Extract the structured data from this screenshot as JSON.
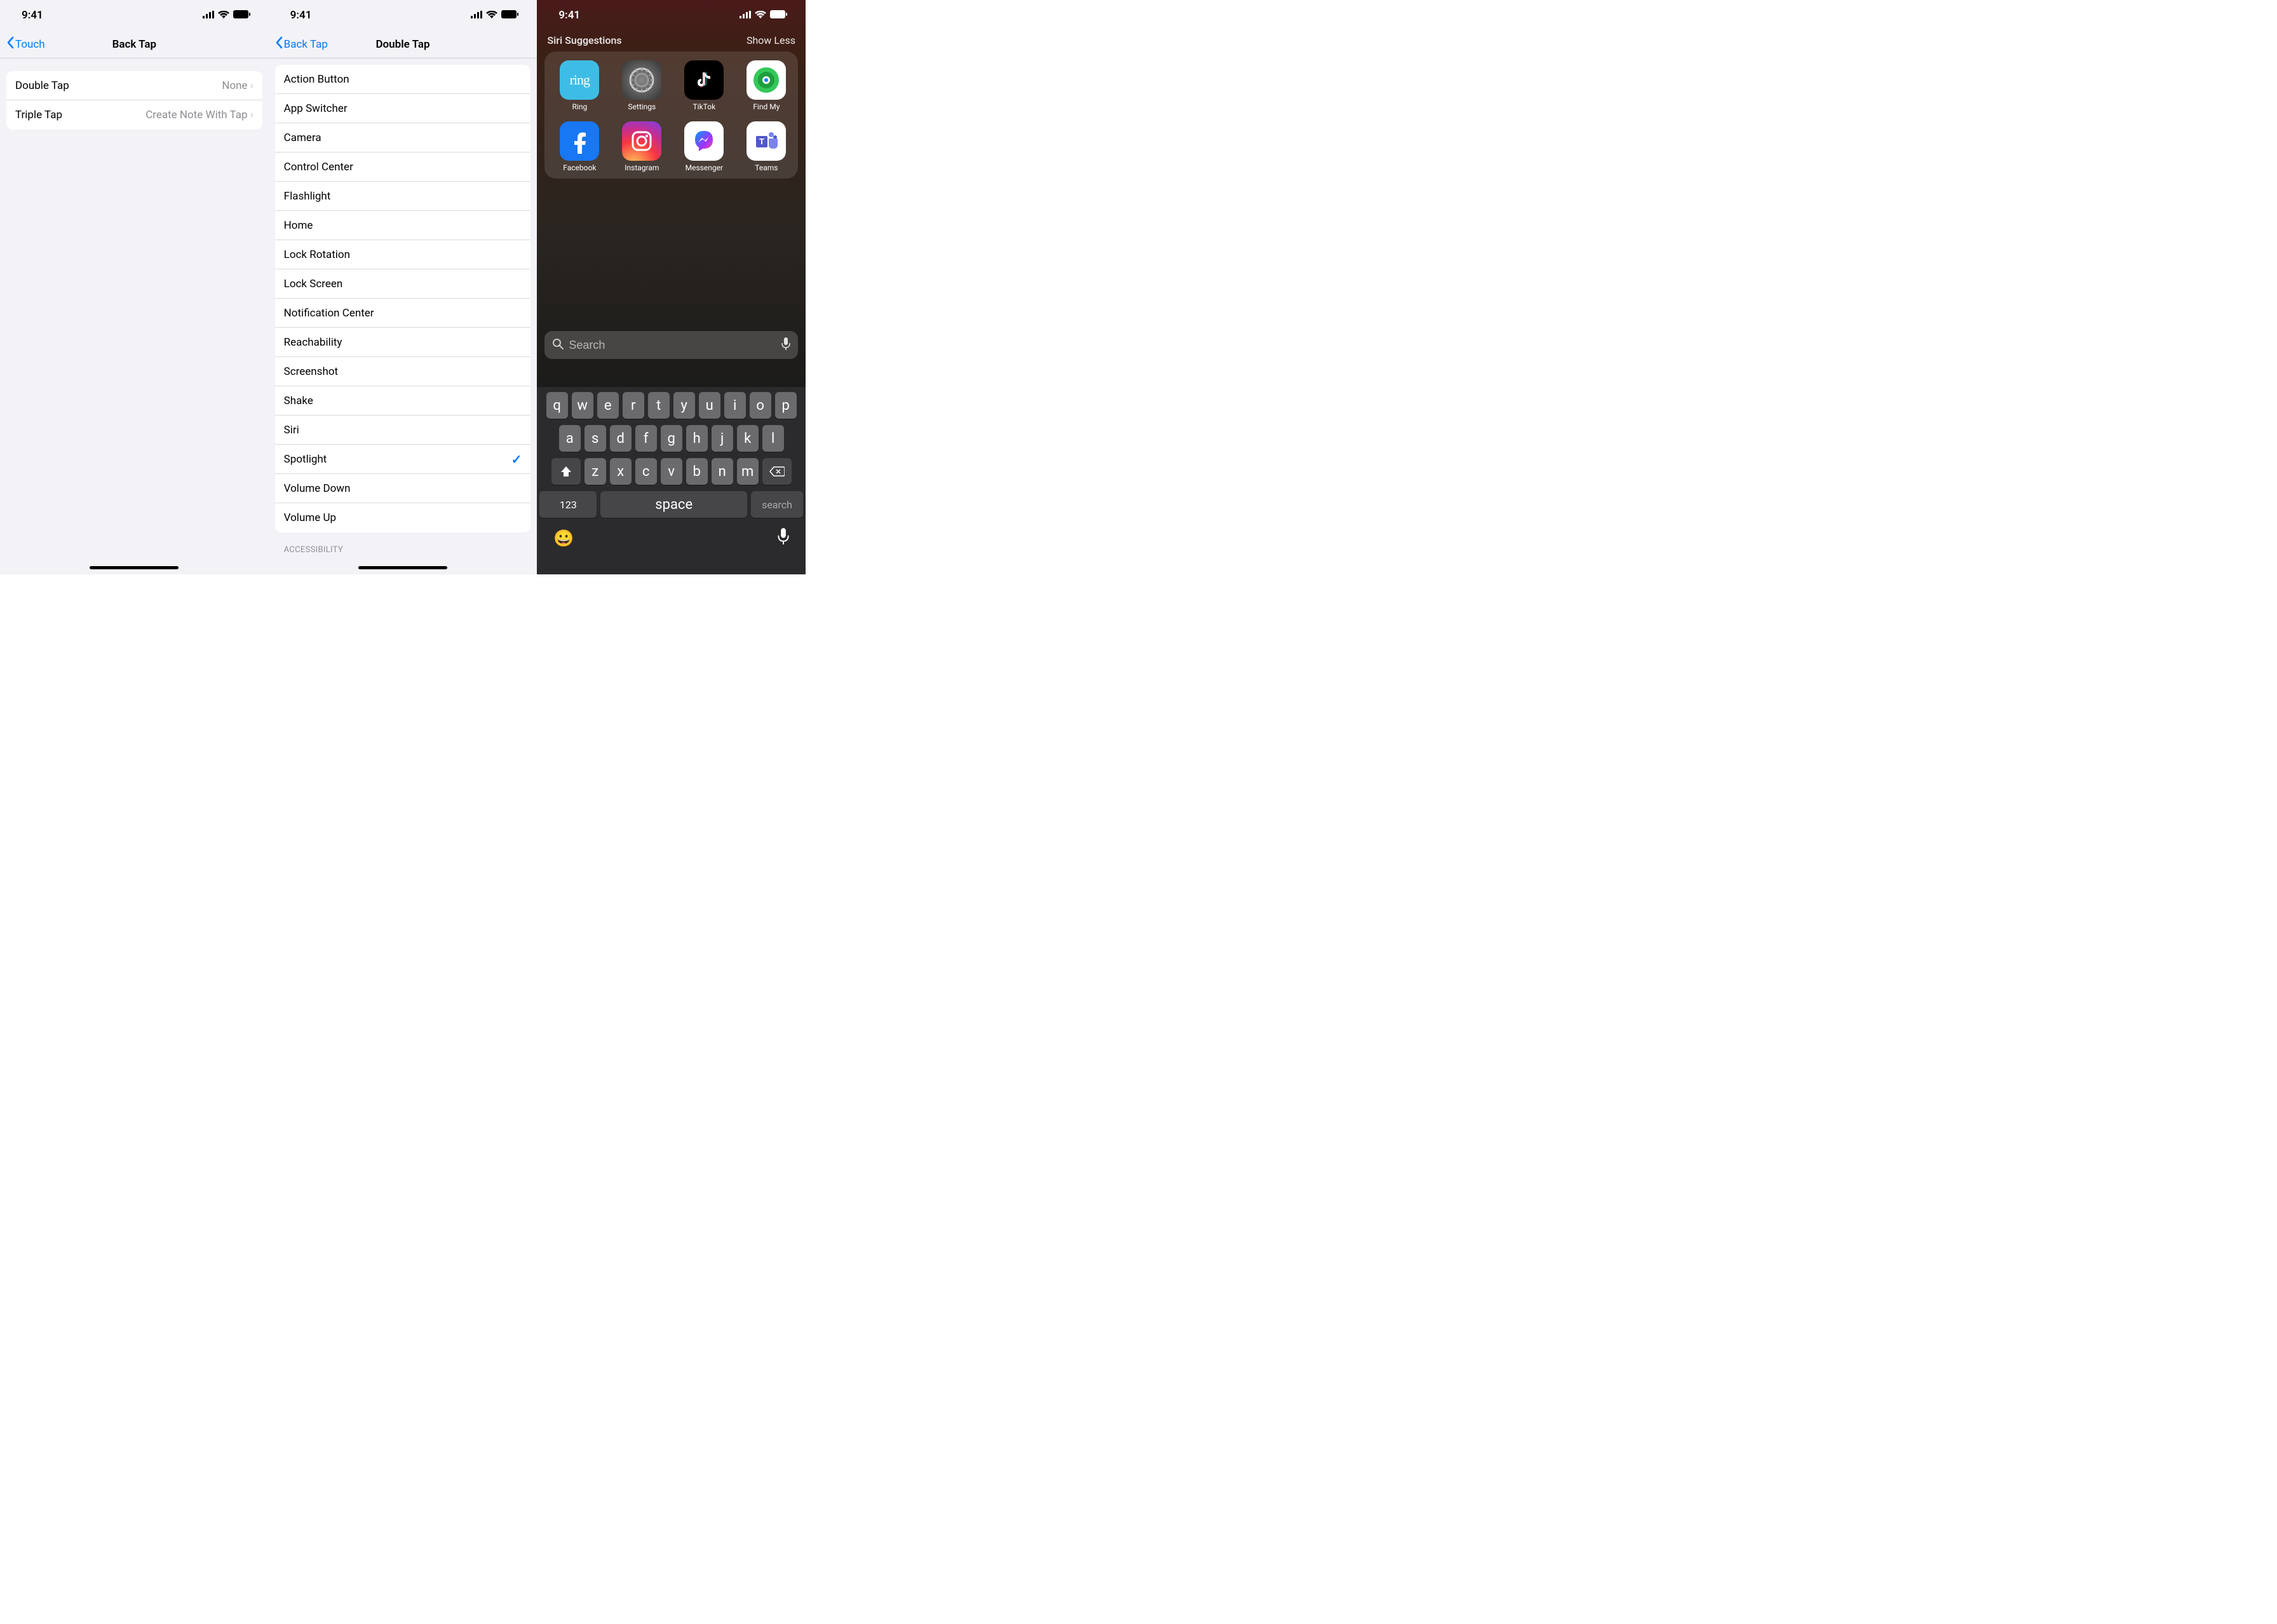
{
  "status": {
    "time": "9:41"
  },
  "screen1": {
    "back_label": "Touch",
    "title": "Back Tap",
    "rows": [
      {
        "label": "Double Tap",
        "value": "None"
      },
      {
        "label": "Triple Tap",
        "value": "Create Note With Tap"
      }
    ]
  },
  "screen2": {
    "back_label": "Back Tap",
    "title": "Double Tap",
    "options": [
      "Action Button",
      "App Switcher",
      "Camera",
      "Control Center",
      "Flashlight",
      "Home",
      "Lock Rotation",
      "Lock Screen",
      "Notification Center",
      "Reachability",
      "Screenshot",
      "Shake",
      "Siri",
      "Spotlight",
      "Volume Down",
      "Volume Up"
    ],
    "selected": "Spotlight",
    "next_section": "ACCESSIBILITY"
  },
  "screen3": {
    "header_left": "Siri Suggestions",
    "header_right": "Show Less",
    "apps": [
      {
        "name": "Ring"
      },
      {
        "name": "Settings"
      },
      {
        "name": "TikTok"
      },
      {
        "name": "Find My"
      },
      {
        "name": "Facebook"
      },
      {
        "name": "Instagram"
      },
      {
        "name": "Messenger"
      },
      {
        "name": "Teams"
      }
    ],
    "search_placeholder": "Search",
    "keyboard": {
      "row1": [
        "q",
        "w",
        "e",
        "r",
        "t",
        "y",
        "u",
        "i",
        "o",
        "p"
      ],
      "row2": [
        "a",
        "s",
        "d",
        "f",
        "g",
        "h",
        "j",
        "k",
        "l"
      ],
      "row3": [
        "z",
        "x",
        "c",
        "v",
        "b",
        "n",
        "m"
      ],
      "num": "123",
      "space": "space",
      "search": "search"
    }
  }
}
